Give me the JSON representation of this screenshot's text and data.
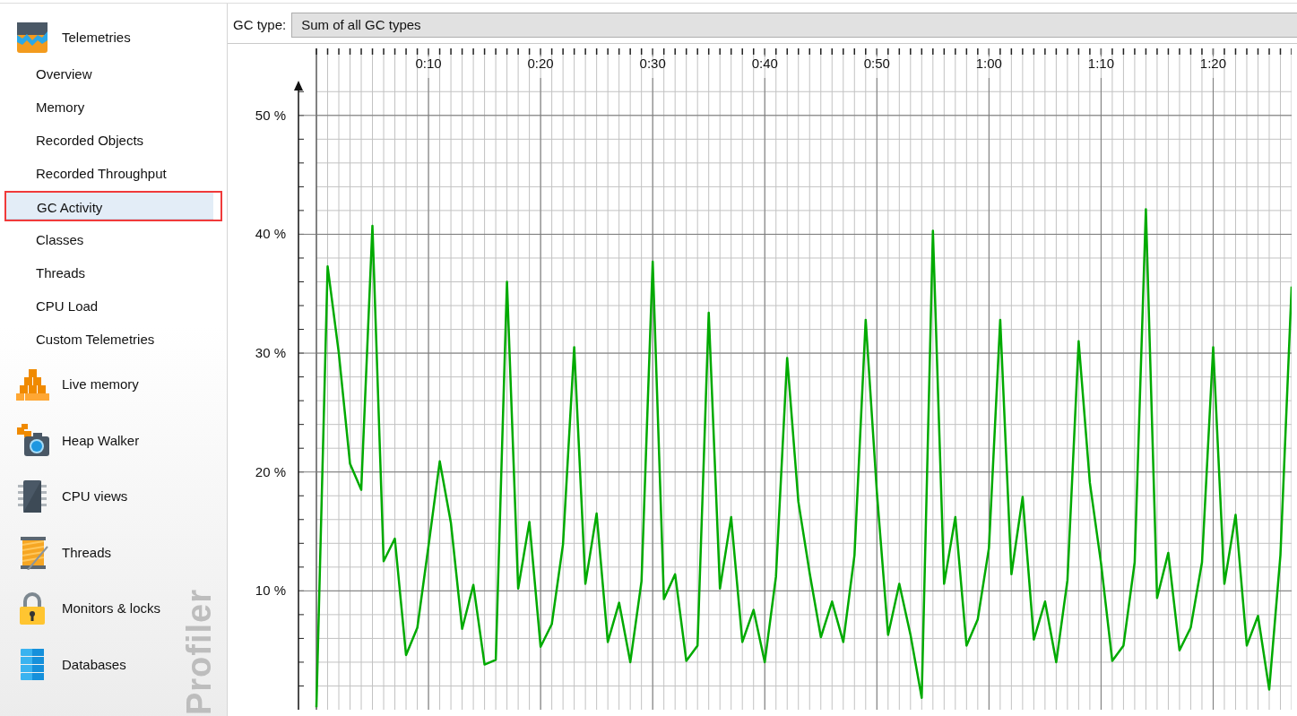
{
  "sidebar": {
    "sections": [
      {
        "label": "Telemetries",
        "children": [
          {
            "label": "Overview",
            "selected": false
          },
          {
            "label": "Memory",
            "selected": false
          },
          {
            "label": "Recorded Objects",
            "selected": false
          },
          {
            "label": "Recorded Throughput",
            "selected": false
          },
          {
            "label": "GC Activity",
            "selected": true
          },
          {
            "label": "Classes",
            "selected": false
          },
          {
            "label": "Threads",
            "selected": false
          },
          {
            "label": "CPU Load",
            "selected": false
          },
          {
            "label": "Custom Telemetries",
            "selected": false
          }
        ]
      },
      {
        "label": "Live memory"
      },
      {
        "label": "Heap Walker"
      },
      {
        "label": "CPU views"
      },
      {
        "label": "Threads"
      },
      {
        "label": "Monitors & locks"
      },
      {
        "label": "Databases"
      }
    ],
    "brand_text": "Profiler"
  },
  "toolbar": {
    "label": "GC type:",
    "value": "Sum of all GC types"
  },
  "chart": {
    "chart_data": {
      "type": "line",
      "grid": true,
      "xlim": [
        0,
        87
      ],
      "ylim": [
        0,
        53
      ],
      "xticks": [
        {
          "value": 10,
          "label": "0:10"
        },
        {
          "value": 20,
          "label": "0:20"
        },
        {
          "value": 30,
          "label": "0:30"
        },
        {
          "value": 40,
          "label": "0:40"
        },
        {
          "value": 50,
          "label": "0:50"
        },
        {
          "value": 60,
          "label": "1:00"
        },
        {
          "value": 70,
          "label": "1:10"
        },
        {
          "value": 80,
          "label": "1:20"
        }
      ],
      "yticks": [
        {
          "value": 10,
          "label": "10 %"
        },
        {
          "value": 20,
          "label": "20 %"
        },
        {
          "value": 30,
          "label": "30 %"
        },
        {
          "value": 40,
          "label": "40 %"
        },
        {
          "value": 50,
          "label": "50 %"
        }
      ],
      "x": [
        0,
        1,
        2,
        3,
        4,
        5,
        6,
        7,
        8,
        9,
        10,
        11,
        12,
        13,
        14,
        15,
        16,
        17,
        18,
        19,
        20,
        21,
        22,
        23,
        24,
        25,
        26,
        27,
        28,
        29,
        30,
        31,
        32,
        33,
        34,
        35,
        36,
        37,
        38,
        39,
        40,
        41,
        42,
        43,
        44,
        45,
        46,
        47,
        48,
        49,
        50,
        51,
        52,
        53,
        54,
        55,
        56,
        57,
        58,
        59,
        60,
        61,
        62,
        63,
        64,
        65,
        66,
        67,
        68,
        69,
        70,
        71,
        72,
        73,
        74,
        75,
        76,
        77,
        78,
        79,
        80,
        81,
        82,
        83,
        84,
        85,
        86,
        87
      ],
      "series": [
        {
          "color": "#00aa00",
          "values": [
            0.2,
            37.3,
            30,
            20.7,
            18.5,
            40.7,
            12.5,
            14.4,
            4.6,
            6.9,
            13.8,
            20.9,
            15.7,
            6.8,
            10.5,
            3.8,
            4.2,
            36,
            10.2,
            15.8,
            5.3,
            7.2,
            13.9,
            30.5,
            10.6,
            16.5,
            5.7,
            9,
            4,
            10.8,
            37.7,
            9.3,
            11.4,
            4.1,
            5.4,
            33.4,
            10.2,
            16.2,
            5.7,
            8.4,
            4,
            11.2,
            29.6,
            17.5,
            11.5,
            6.1,
            9.1,
            5.7,
            13,
            32.8,
            18.3,
            6.3,
            10.6,
            6.3,
            1,
            40.3,
            10.6,
            16.2,
            5.4,
            7.6,
            13.6,
            32.8,
            11.4,
            17.9,
            5.9,
            9.1,
            4,
            10.9,
            31,
            19.1,
            12.3,
            4.1,
            5.4,
            12.4,
            42.1,
            9.4,
            13.2,
            5,
            6.9,
            12.4,
            30.5,
            10.6,
            16.4,
            5.4,
            7.9,
            1.7,
            13,
            35.6
          ]
        }
      ]
    }
  }
}
